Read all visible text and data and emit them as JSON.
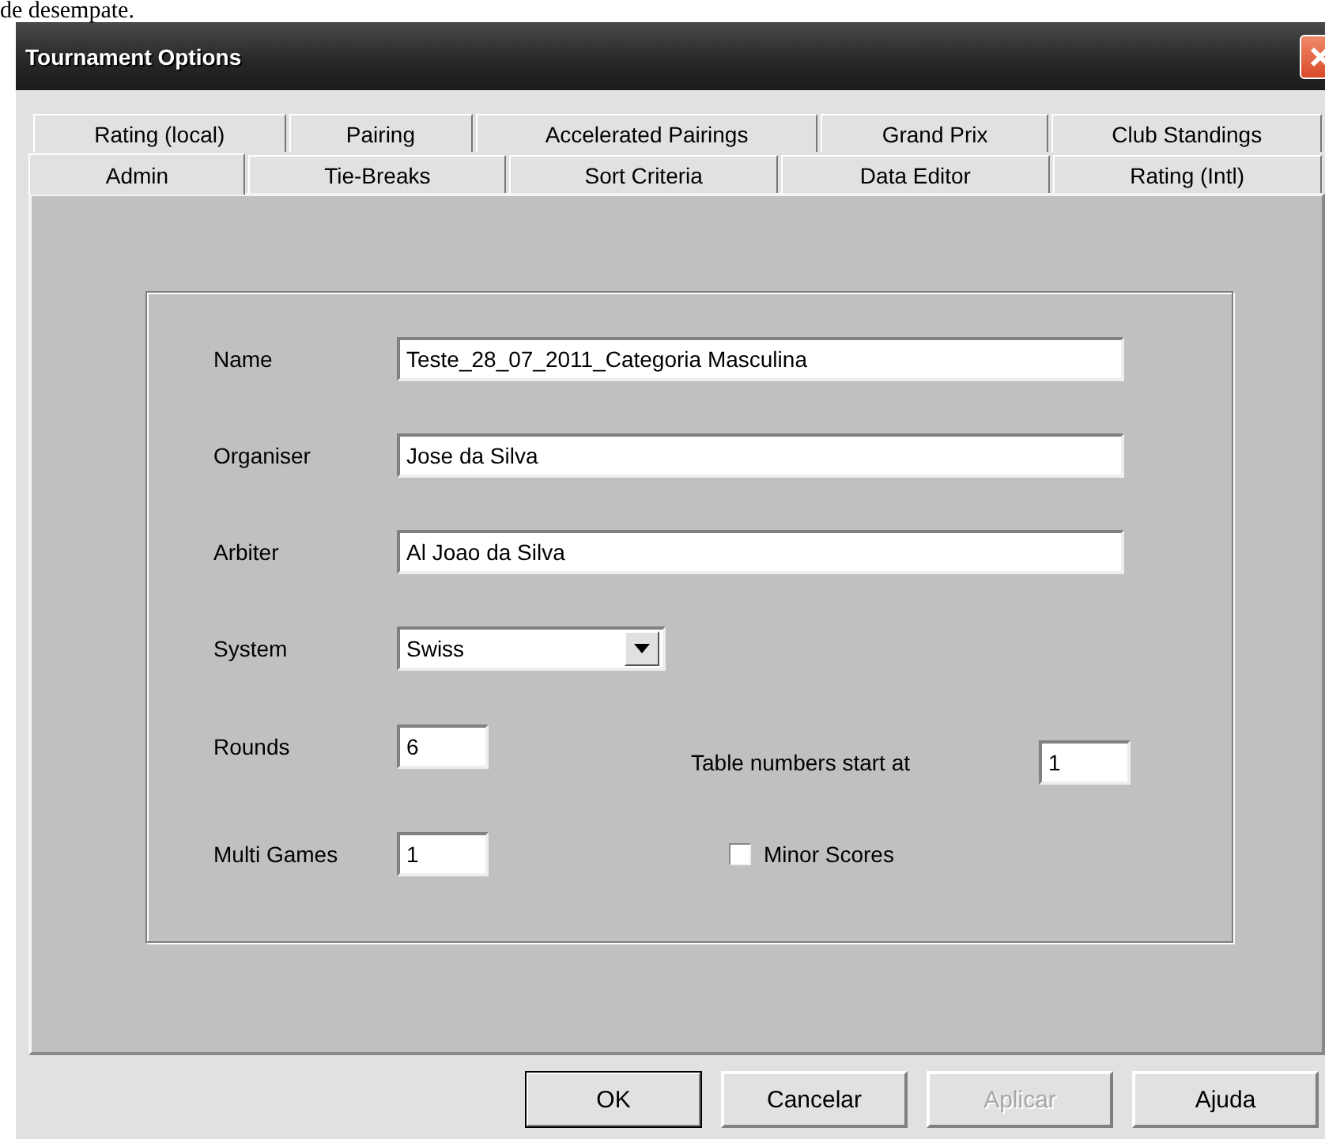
{
  "page_caption": "de desempate.",
  "window": {
    "title": "Tournament Options"
  },
  "tab_rows": [
    [
      {
        "label": "Rating (local)",
        "selected": false
      },
      {
        "label": "Pairing",
        "selected": false
      },
      {
        "label": "Accelerated Pairings",
        "selected": false
      },
      {
        "label": "Grand Prix",
        "selected": false
      },
      {
        "label": "Club Standings",
        "selected": false
      }
    ],
    [
      {
        "label": "Admin",
        "selected": true
      },
      {
        "label": "Tie-Breaks",
        "selected": false
      },
      {
        "label": "Sort Criteria",
        "selected": false
      },
      {
        "label": "Data Editor",
        "selected": false
      },
      {
        "label": "Rating (Intl)",
        "selected": false
      }
    ]
  ],
  "fields": [
    {
      "kind": "text",
      "label": "Name",
      "value": "Teste_28_07_2011_Categoria Masculina"
    },
    {
      "kind": "text",
      "label": "Organiser",
      "value": "Jose da Silva"
    },
    {
      "kind": "text",
      "label": "Arbiter",
      "value": "Al Joao da Silva"
    },
    {
      "kind": "select",
      "label": "System",
      "value": "Swiss"
    }
  ],
  "rounds": {
    "label": "Rounds",
    "value": "6"
  },
  "multi_games": {
    "label": "Multi Games",
    "value": "1"
  },
  "table_numbers": {
    "label": "Table numbers start at",
    "value": "1"
  },
  "minor_scores": {
    "label": "Minor Scores",
    "checked": false
  },
  "buttons": [
    {
      "label": "OK",
      "default": true,
      "disabled": false
    },
    {
      "label": "Cancelar",
      "default": false,
      "disabled": false
    },
    {
      "label": "Aplicar",
      "default": false,
      "disabled": true
    },
    {
      "label": "Ajuda",
      "default": false,
      "disabled": false
    }
  ]
}
